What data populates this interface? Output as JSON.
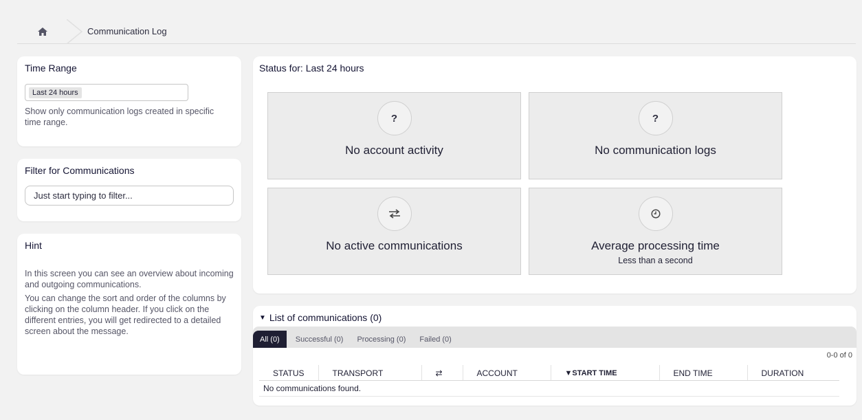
{
  "breadcrumb": {
    "current": "Communication Log"
  },
  "time_range": {
    "title": "Time Range",
    "selected": "Last 24 hours",
    "description": "Show only communication logs created in specific time range."
  },
  "filter": {
    "title": "Filter for Communications",
    "placeholder": "Just start typing to filter..."
  },
  "hint": {
    "title": "Hint",
    "p1": "In this screen you can see an overview about incoming and outgoing communications.",
    "p2": "You can change the sort and order of the columns by clicking on the column header. If you click on the different entries, you will get redirected to a detailed screen about the message."
  },
  "status": {
    "title": "Status for: Last 24 hours",
    "tiles": [
      {
        "icon": "question-icon",
        "glyph": "?",
        "label": "No account activity"
      },
      {
        "icon": "question-icon",
        "glyph": "?",
        "label": "No communication logs"
      },
      {
        "icon": "exchange-icon",
        "glyph": "⇄",
        "label": "No active communications"
      },
      {
        "icon": "clock-icon",
        "glyph": "◷",
        "label": "Average processing time",
        "sub": "Less than a second"
      }
    ]
  },
  "list": {
    "title": "List of communications (0)",
    "tabs": [
      "All (0)",
      "Successful (0)",
      "Processing (0)",
      "Failed (0)"
    ],
    "pager": "0-0 of 0",
    "columns": [
      "STATUS",
      "TRANSPORT",
      "⇄",
      "ACCOUNT",
      "▼START TIME",
      "END TIME",
      "DURATION"
    ],
    "empty": "No communications found."
  }
}
